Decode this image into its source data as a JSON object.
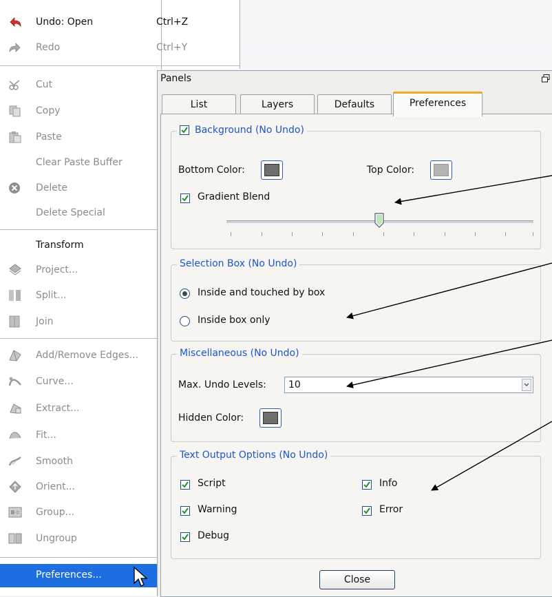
{
  "menu": {
    "items": [
      {
        "label": "Undo: Open",
        "shortcut": "Ctrl+Z",
        "icon": "undo-icon",
        "enabled": true
      },
      {
        "label": "Redo",
        "shortcut": "Ctrl+Y",
        "icon": "redo-icon",
        "enabled": false
      },
      {
        "label": "Cut",
        "icon": "scissors-icon",
        "enabled": false
      },
      {
        "label": "Copy",
        "icon": "copy-icon",
        "enabled": false
      },
      {
        "label": "Paste",
        "icon": "paste-icon",
        "enabled": false
      },
      {
        "label": "Clear Paste Buffer",
        "enabled": false
      },
      {
        "label": "Delete",
        "icon": "delete-icon",
        "enabled": false
      },
      {
        "label": "Delete Special",
        "enabled": false
      },
      {
        "label": "Transform",
        "enabled": true
      },
      {
        "label": "Project...",
        "icon": "project-icon",
        "enabled": false
      },
      {
        "label": "Split...",
        "icon": "split-icon",
        "enabled": false
      },
      {
        "label": "Join",
        "icon": "join-icon",
        "enabled": false
      },
      {
        "label": "Add/Remove Edges...",
        "icon": "edges-icon",
        "enabled": false
      },
      {
        "label": "Curve...",
        "icon": "curve-icon",
        "enabled": false
      },
      {
        "label": "Extract...",
        "icon": "extract-icon",
        "enabled": false
      },
      {
        "label": "Fit...",
        "icon": "fit-icon",
        "enabled": false
      },
      {
        "label": "Smooth",
        "icon": "smooth-icon",
        "enabled": false
      },
      {
        "label": "Orient...",
        "icon": "orient-icon",
        "enabled": false
      },
      {
        "label": "Group...",
        "icon": "group-icon",
        "enabled": false
      },
      {
        "label": "Ungroup",
        "icon": "ungroup-icon",
        "enabled": false
      },
      {
        "label": "Preferences...",
        "enabled": true,
        "selected": true
      }
    ]
  },
  "panels": {
    "title": "Panels",
    "tabs": [
      "List",
      "Layers",
      "Defaults",
      "Preferences"
    ],
    "active_tab": "Preferences",
    "background": {
      "legend": "Background (No Undo)",
      "checked": true,
      "bottom_color_label": "Bottom Color:",
      "bottom_color": "#6e6e6e",
      "top_color_label": "Top Color:",
      "top_color": "#b4b4b4",
      "gradient_blend_label": "Gradient Blend",
      "gradient_blend_checked": true,
      "blend_position": 0.5
    },
    "selection_box": {
      "legend": "Selection Box (No Undo)",
      "options": [
        "Inside and touched by box",
        "Inside box only"
      ],
      "selected": 0
    },
    "misc": {
      "legend": "Miscellaneous (No Undo)",
      "undo_label": "Max. Undo Levels:",
      "undo_value": "10",
      "hidden_color_label": "Hidden Color:",
      "hidden_color": "#6e6e6e"
    },
    "text_output": {
      "legend": "Text Output Options (No Undo)",
      "options": [
        {
          "label": "Script",
          "checked": true
        },
        {
          "label": "Info",
          "checked": true
        },
        {
          "label": "Warning",
          "checked": true
        },
        {
          "label": "Error",
          "checked": true
        },
        {
          "label": "Debug",
          "checked": true
        }
      ]
    },
    "close_label": "Close"
  },
  "colors": {
    "accent": "#1c56cc",
    "selection": "#1d6ee0",
    "tab_highlight": "#f4a52a"
  }
}
